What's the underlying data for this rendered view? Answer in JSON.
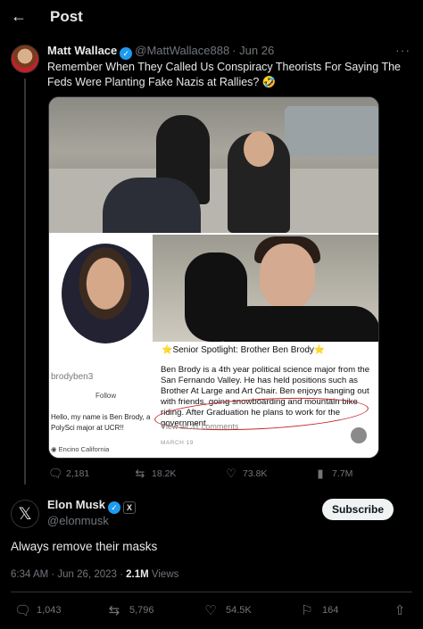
{
  "header": {
    "back_icon": "arrow-left-icon",
    "title": "Post"
  },
  "quoted_tweet": {
    "author_name": "Matt Wallace",
    "author_handle": "@MattWallace888",
    "date": "· Jun 26",
    "text": "Remember When They Called Us Conspiracy Theorists For Saying The Feds Were Planting Fake Nazis at Rallies? 🤣",
    "media": {
      "profile_handle": "brodyben3",
      "follow_label": "Follow",
      "bio": "Hello, my name is Ben Brody, a PolySci major at UCR!!",
      "location": "Encino California",
      "spotlight_title": "⭐Senior Spotlight: Brother Ben Brody⭐",
      "spotlight_body": "Ben Brody is a 4th year political science major from the San Fernando Valley. He has held positions such as Brother At Large and Art Chair. Ben enjoys hanging out with friends, going snowboarding and mountain bike riding. After Graduation he plans to work for the government.",
      "spotlight_comments": "View all 31 comments",
      "spotlight_date": "MARCH 19"
    },
    "stats": {
      "replies": "2,181",
      "reposts": "18.2K",
      "likes": "73.8K",
      "views": "7.7M"
    }
  },
  "main_tweet": {
    "author_name": "Elon Musk",
    "author_handle": "@elonmusk",
    "badge_label": "X",
    "subscribe_label": "Subscribe",
    "text": "Always remove their masks",
    "timestamp": "6:34 AM · Jun 26, 2023 · ",
    "views_count": "2.1M",
    "views_label": " Views",
    "stats": {
      "replies": "1,043",
      "reposts": "5,796",
      "likes": "54.5K",
      "bookmarks": "164"
    }
  },
  "colors": {
    "background": "#000000",
    "accent": "#1d9bf0",
    "muted": "#71767b",
    "circle": "#c1272d"
  }
}
